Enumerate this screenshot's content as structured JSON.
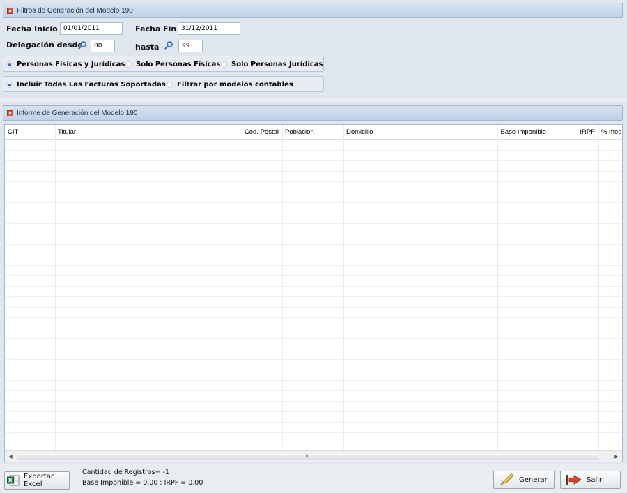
{
  "filters": {
    "header_title": "Filtros de Generación del Modelo 190",
    "fecha_inicio_label": "Fecha Inicio",
    "fecha_inicio_value": "01/01/2011",
    "fecha_fin_label": "Fecha Fin",
    "fecha_fin_value": "31/12/2011",
    "delegacion_desde_label": "Delegación desde",
    "delegacion_desde_value": "00",
    "hasta_label": "hasta",
    "hasta_value": "99",
    "personas_options": [
      {
        "label": "Personas Físicas y Jurídicas",
        "selected": true
      },
      {
        "label": "Solo Personas Físicas",
        "selected": false
      },
      {
        "label": "Solo Personas Jurídicas",
        "selected": false
      }
    ],
    "facturas_options": [
      {
        "label": "Incluir Todas Las Facturas Soportadas",
        "selected": true
      },
      {
        "label": "Filtrar por modelos contables",
        "selected": false
      }
    ]
  },
  "report": {
    "header_title": "Informe de Generación del Modelo 190",
    "columns": [
      "CIT",
      "Titular",
      "Cod. Postal",
      "Población",
      "Domicilio",
      "Base Imponible",
      "IRPF",
      "% med"
    ],
    "rows": [],
    "scroll_grip": "III"
  },
  "footer": {
    "export_label": "Exportar Excel",
    "count_text": "Cantidad de Registros= -1",
    "totals_text": "Base Imponible = 0,00 ; IRPF = 0,00",
    "generate_label": "Generar",
    "exit_label": "Salir"
  },
  "colors": {
    "header_gradient_top": "#d6e3f1",
    "header_gradient_bottom": "#bfd2e7",
    "panel_bg": "#dfe6ee",
    "radio_selected": "#2f62b6",
    "accent_icon": "#e0532b"
  },
  "icons": {
    "search": "search-icon",
    "excel": "excel-icon",
    "generate": "pencil-icon",
    "exit": "exit-icon"
  }
}
